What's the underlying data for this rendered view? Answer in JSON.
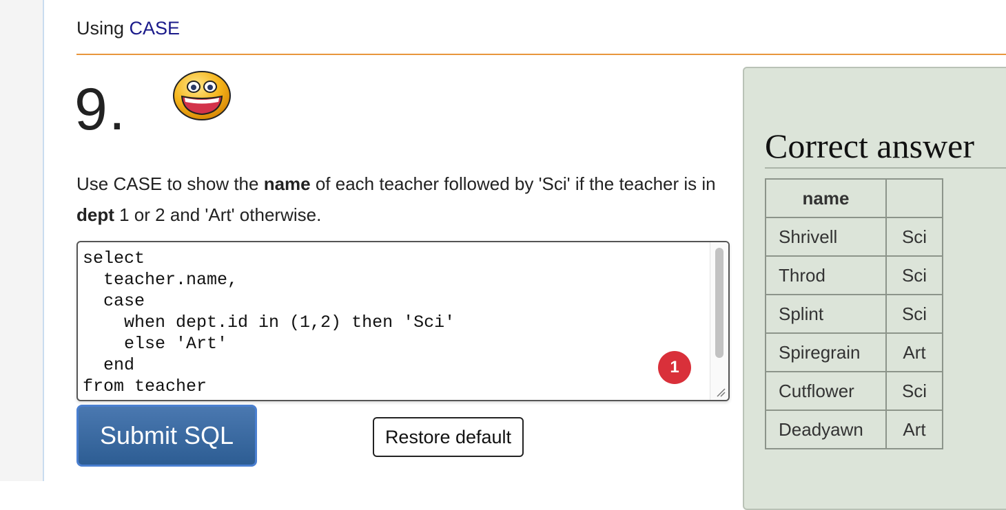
{
  "breadcrumb": {
    "prefix": "Using ",
    "link": "CASE"
  },
  "question": {
    "number": "9.",
    "text_1": "Use CASE to show the ",
    "bold_1": "name",
    "text_2": " of each teacher followed by 'Sci' if the teacher is in ",
    "bold_2": "dept",
    "text_3": " 1 or 2 and 'Art' otherwise."
  },
  "editor": {
    "code": "select\n  teacher.name,\n  case\n    when dept.id in (1,2) then 'Sci'\n    else 'Art'\n  end\nfrom teacher",
    "badge": "1"
  },
  "buttons": {
    "submit": "Submit SQL",
    "restore": "Restore default"
  },
  "answer": {
    "title": "Correct answer",
    "headers": [
      "name",
      ""
    ],
    "rows": [
      [
        "Shrivell",
        "Sci"
      ],
      [
        "Throd",
        "Sci"
      ],
      [
        "Splint",
        "Sci"
      ],
      [
        "Spiregrain",
        "Art"
      ],
      [
        "Cutflower",
        "Sci"
      ],
      [
        "Deadyawn",
        "Art"
      ]
    ]
  },
  "colors": {
    "accent_rule": "#e8963c",
    "link": "#1a1a8a",
    "submit": "#2d5d93",
    "panel": "#dce4d9",
    "badge": "#d9303a"
  },
  "icons": {
    "smiley": "laughing-smiley-icon"
  }
}
